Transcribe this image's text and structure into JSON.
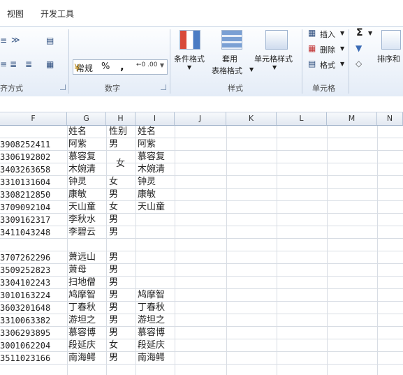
{
  "tabs": [
    "视图",
    "开发工具"
  ],
  "ribbon": {
    "groups": {
      "alignment": "齐方式",
      "number": "数字",
      "styles": "样式",
      "cells": "单元格"
    },
    "number_format": "常规",
    "percent": "%",
    "comma": ",",
    "inc_decimal": "←0 .00",
    "dec_decimal": ".00 →0",
    "cond_format": "条件格式",
    "table_format_1": "套用",
    "table_format_2": "表格格式",
    "cell_styles": "单元格样式",
    "insert": "插入",
    "delete": "删除",
    "format": "格式",
    "sum": "Σ",
    "sort": "排序和"
  },
  "columns": [
    "F",
    "G",
    "H",
    "I",
    "J",
    "K",
    "L",
    "M",
    "N"
  ],
  "rows": [
    {
      "f": "",
      "g": "姓名",
      "h": "性别",
      "i": "姓名"
    },
    {
      "f": "3908252411",
      "g": "阿紫",
      "h": "男",
      "i": "阿紫"
    },
    {
      "f": "3306192802",
      "g": "慕容复",
      "h": "",
      "i": "慕容复"
    },
    {
      "f": "3403263658",
      "g": "木婉清",
      "h": "",
      "i": "木婉清"
    },
    {
      "f": "3310131604",
      "g": "钟灵",
      "h": "女",
      "i": "钟灵"
    },
    {
      "f": "3308212850",
      "g": "康敏",
      "h": "男",
      "i": "康敏"
    },
    {
      "f": "3709092104",
      "g": "天山童",
      "h": "女",
      "i": "天山童"
    },
    {
      "f": "3309162317",
      "g": "李秋水",
      "h": "男",
      "i": ""
    },
    {
      "f": "3411043248",
      "g": "李碧云",
      "h": "男",
      "i": ""
    },
    {
      "f": "",
      "g": "",
      "h": "",
      "i": ""
    },
    {
      "f": "3707262296",
      "g": "萧远山",
      "h": "男",
      "i": ""
    },
    {
      "f": "3509252823",
      "g": "萧母",
      "h": "男",
      "i": ""
    },
    {
      "f": "3304102243",
      "g": "扫地僧",
      "h": "男",
      "i": ""
    },
    {
      "f": "3010163224",
      "g": "鸠摩智",
      "h": "男",
      "i": "鸠摩智"
    },
    {
      "f": "3603201648",
      "g": "丁春秋",
      "h": "男",
      "i": "丁春秋"
    },
    {
      "f": "3310063382",
      "g": "游坦之",
      "h": "男",
      "i": "游坦之"
    },
    {
      "f": "3306293895",
      "g": "慕容博",
      "h": "男",
      "i": "慕容博"
    },
    {
      "f": "3001062204",
      "g": "段延庆",
      "h": "女",
      "i": "段延庆"
    },
    {
      "f": "3511023166",
      "g": "南海鳄",
      "h": "男",
      "i": "南海鳄"
    }
  ],
  "merged_h": "女"
}
